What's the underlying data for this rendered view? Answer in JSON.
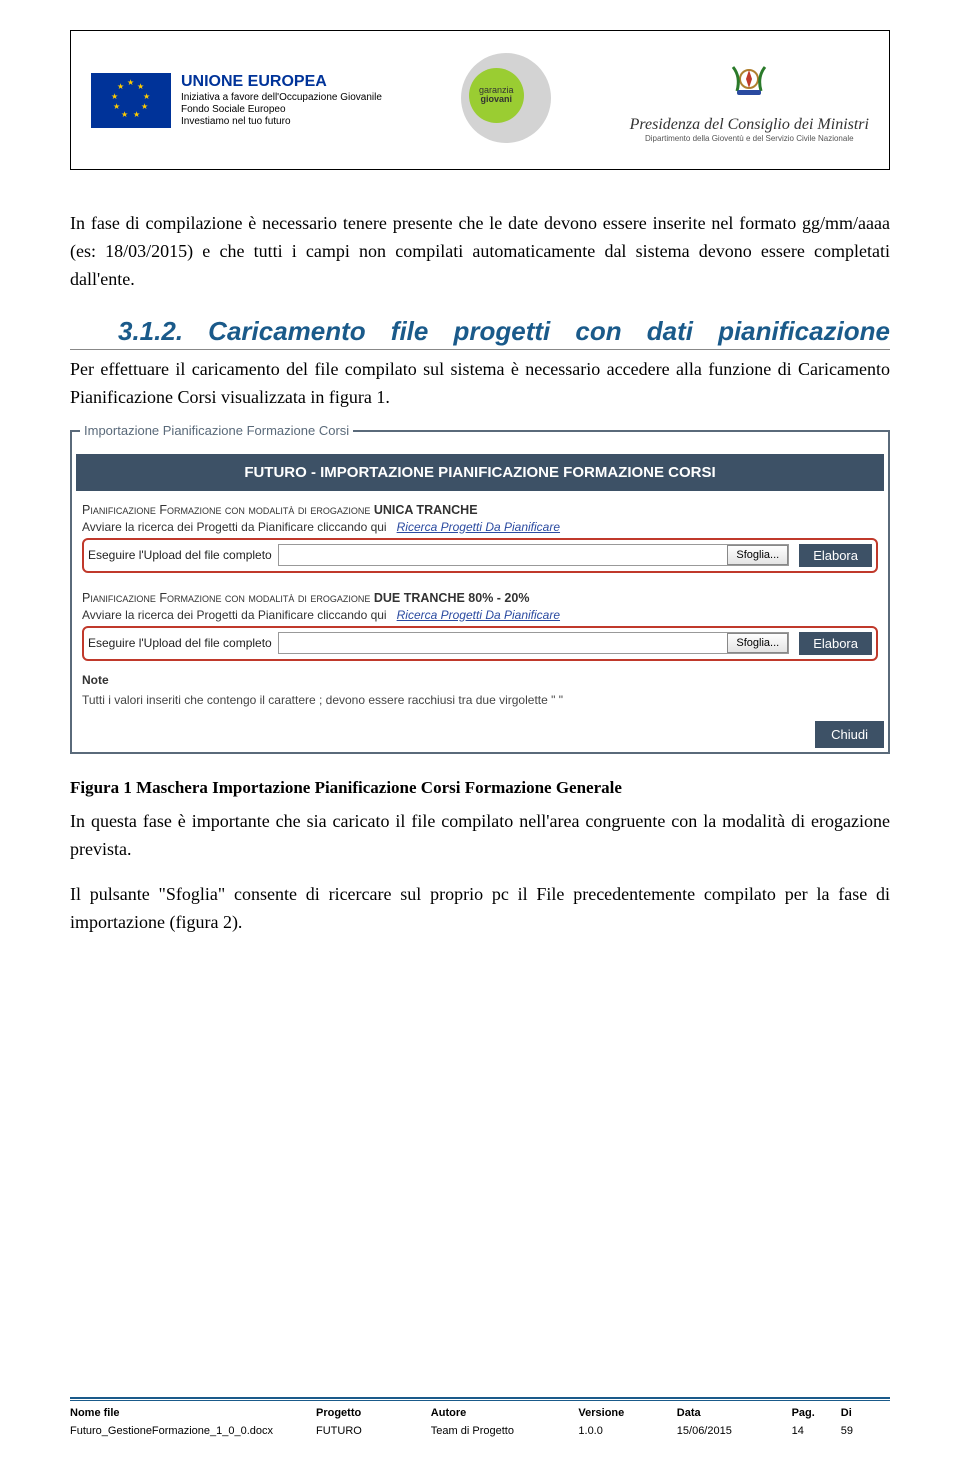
{
  "header": {
    "eu": {
      "title": "UNIONE EUROPEA",
      "line1": "Iniziativa a favore dell'Occupazione Giovanile",
      "line2": "Fondo Sociale Europeo",
      "line3": "Investiamo nel tuo futuro"
    },
    "giovani": {
      "label1": "garanzia",
      "label2": "giovani"
    },
    "presidenza": {
      "title": "Presidenza del Consiglio dei Ministri",
      "subtitle": "Dipartimento della Gioventù e del Servizio Civile Nazionale"
    }
  },
  "body": {
    "p1": "In fase di compilazione è necessario tenere presente che le date devono essere inserite nel formato gg/mm/aaaa (es: 18/03/2015) e che tutti i campi non compilati automaticamente dal sistema devono essere completati dall'ente.",
    "heading": "3.1.2.   Caricamento   file   progetti   con   dati pianificazione",
    "p2": "Per effettuare il caricamento del file compilato sul sistema è necessario accedere alla funzione di Caricamento Pianificazione Corsi visualizzata in figura 1.",
    "caption": "Figura 1 Maschera Importazione Pianificazione Corsi Formazione Generale",
    "p3": "In questa fase è importante che sia caricato il file compilato nell'area congruente con la modalità di erogazione prevista.",
    "p4": "Il pulsante \"Sfoglia\" consente di ricercare sul proprio pc il File precedentemente compilato per la fase di importazione (figura 2)."
  },
  "shot": {
    "legend": "Importazione Pianificazione Formazione Corsi",
    "headerTitle": "FUTURO - IMPORTAZIONE PIANIFICAZIONE FORMAZIONE CORSI",
    "section1": {
      "title_a": "Pianificazione Formazione con modalità di erogazione ",
      "title_b": "UNICA TRANCHE",
      "searchLabel": "Avviare la ricerca dei Progetti da Pianificare cliccando qui",
      "searchLink": "Ricerca Progetti Da Pianificare",
      "uploadLabel": "Eseguire l'Upload del file completo",
      "sfoglia": "Sfoglia...",
      "elabora": "Elabora"
    },
    "section2": {
      "title_a": "Pianificazione Formazione con modalità di erogazione ",
      "title_b": "DUE TRANCHE 80% - 20%",
      "searchLabel": "Avviare la ricerca dei Progetti da Pianificare cliccando qui",
      "searchLink": "Ricerca Progetti Da Pianificare",
      "uploadLabel": "Eseguire l'Upload del file completo",
      "sfoglia": "Sfoglia...",
      "elabora": "Elabora"
    },
    "noteLabel": "Note",
    "noteText": "Tutti i valori inseriti che contengo il carattere ; devono essere racchiusi tra due virgolette \" \"",
    "chiudi": "Chiudi"
  },
  "footer": {
    "headers": {
      "nome": "Nome file",
      "progetto": "Progetto",
      "autore": "Autore",
      "versione": "Versione",
      "data": "Data",
      "pag": "Pag.",
      "di": "Di"
    },
    "values": {
      "nome": "Futuro_GestioneFormazione_1_0_0.docx",
      "progetto": "FUTURO",
      "autore": "Team di Progetto",
      "versione": "1.0.0",
      "data": "15/06/2015",
      "pag": "14",
      "di": "59"
    }
  }
}
